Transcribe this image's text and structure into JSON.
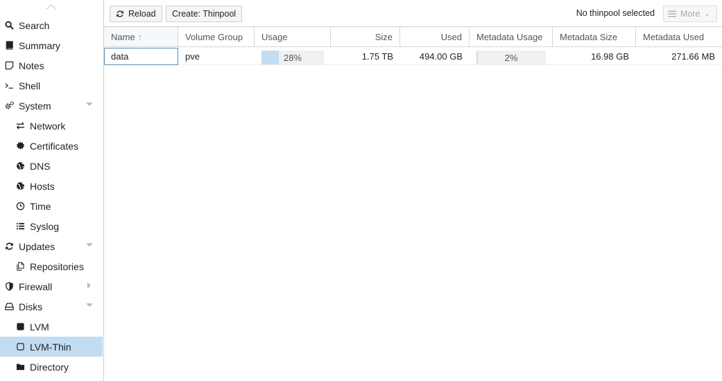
{
  "sidebar": {
    "items": [
      {
        "label": "Search",
        "icon": "search-icon",
        "level": 0
      },
      {
        "label": "Summary",
        "icon": "book-icon",
        "level": 0
      },
      {
        "label": "Notes",
        "icon": "sticky-note-icon",
        "level": 0
      },
      {
        "label": "Shell",
        "icon": "terminal-icon",
        "level": 0
      },
      {
        "label": "System",
        "icon": "cogs-icon",
        "level": 0,
        "expanded": true
      },
      {
        "label": "Network",
        "icon": "exchange-icon",
        "level": 1
      },
      {
        "label": "Certificates",
        "icon": "certificate-icon",
        "level": 1
      },
      {
        "label": "DNS",
        "icon": "globe-icon",
        "level": 1
      },
      {
        "label": "Hosts",
        "icon": "globe-icon",
        "level": 1
      },
      {
        "label": "Time",
        "icon": "clock-icon",
        "level": 1
      },
      {
        "label": "Syslog",
        "icon": "list-icon",
        "level": 1
      },
      {
        "label": "Updates",
        "icon": "refresh-icon",
        "level": 0,
        "expanded": true
      },
      {
        "label": "Repositories",
        "icon": "files-icon",
        "level": 1
      },
      {
        "label": "Firewall",
        "icon": "shield-icon",
        "level": 0,
        "expanded": false
      },
      {
        "label": "Disks",
        "icon": "hdd-icon",
        "level": 0,
        "expanded": true
      },
      {
        "label": "LVM",
        "icon": "square-icon",
        "level": 1
      },
      {
        "label": "LVM-Thin",
        "icon": "square-outline-icon",
        "level": 1,
        "selected": true
      },
      {
        "label": "Directory",
        "icon": "folder-icon",
        "level": 1
      }
    ]
  },
  "toolbar": {
    "reload_label": "Reload",
    "create_label": "Create: Thinpool",
    "status_text": "No thinpool selected",
    "more_label": "More"
  },
  "grid": {
    "columns": [
      "Name",
      "Volume Group",
      "Usage",
      "Size",
      "Used",
      "Metadata Usage",
      "Metadata Size",
      "Metadata Used"
    ],
    "sort_column": "Name",
    "sort_direction": "asc",
    "rows": [
      {
        "name": "data",
        "volume_group": "pve",
        "usage": "28%",
        "usage_fraction": 0.28,
        "size": "1.75 TB",
        "used": "494.00 GB",
        "metadata_usage": "2%",
        "metadata_usage_fraction": 0.02,
        "metadata_size": "16.98 GB",
        "metadata_used": "271.66 MB"
      }
    ]
  },
  "colors": {
    "selection": "#c2ddf2",
    "progress_fill": "#c2ddf2",
    "focus_border": "#5e8fb6"
  }
}
